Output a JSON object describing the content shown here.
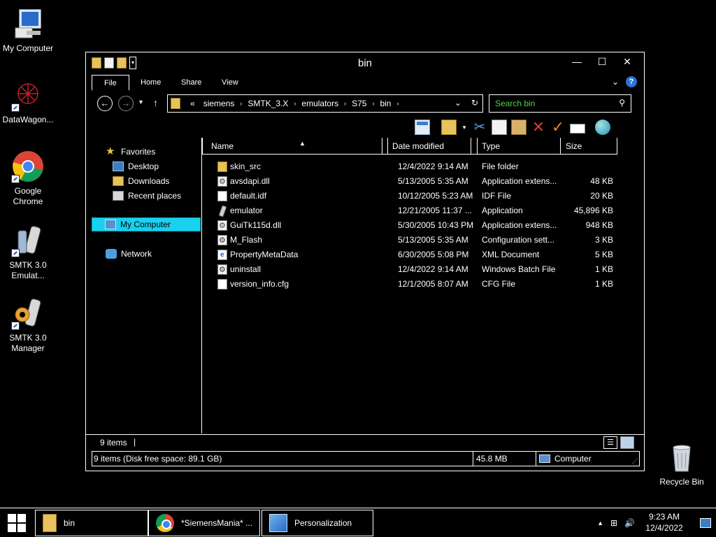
{
  "desktop": {
    "icons": [
      {
        "label": "My Computer"
      },
      {
        "label": "DataWagon..."
      },
      {
        "label": "Google Chrome"
      },
      {
        "label": "SMTK 3.0 Emulat..."
      },
      {
        "label": "SMTK 3.0 Manager"
      },
      {
        "label": "Recycle Bin"
      }
    ]
  },
  "window": {
    "title": "bin",
    "controls": {
      "minimize": "—",
      "maximize": "☐",
      "close": "✕"
    },
    "ribbon": {
      "tabs": [
        "File",
        "Home",
        "Share",
        "View"
      ],
      "help": "?"
    },
    "nav": {
      "back": "←",
      "forward": "→",
      "recent": "▾",
      "up": "↑",
      "address_prefix": "«",
      "breadcrumb": [
        "siemens",
        "SMTK_3.X",
        "emulators",
        "S75",
        "bin"
      ],
      "separator": "›",
      "dropdown": "⌄",
      "refresh": "↻",
      "search_placeholder": "Search bin",
      "search_icon": "⚲"
    },
    "sidebar": {
      "favorites": "Favorites",
      "items": [
        "Desktop",
        "Downloads",
        "Recent places"
      ],
      "computer": "My Computer",
      "network": "Network"
    },
    "columns": {
      "name": "Name",
      "date": "Date modified",
      "type": "Type",
      "size": "Size"
    },
    "files": [
      {
        "name": "skin_src",
        "date": "12/4/2022 9:14 AM",
        "type": "File folder",
        "size": "",
        "icon": "folder"
      },
      {
        "name": "avsdapi.dll",
        "date": "5/13/2005 5:35 AM",
        "type": "Application extens...",
        "size": "48 KB",
        "icon": "dll"
      },
      {
        "name": "default.idf",
        "date": "10/12/2005 5:23 AM",
        "type": "IDF File",
        "size": "20 KB",
        "icon": "file"
      },
      {
        "name": "emulator",
        "date": "12/21/2005 11:37 ...",
        "type": "Application",
        "size": "45,896 KB",
        "icon": "app"
      },
      {
        "name": "GuiTk115d.dll",
        "date": "5/30/2005 10:43 PM",
        "type": "Application extens...",
        "size": "948 KB",
        "icon": "dll"
      },
      {
        "name": "M_Flash",
        "date": "5/13/2005 5:35 AM",
        "type": "Configuration sett...",
        "size": "3 KB",
        "icon": "config"
      },
      {
        "name": "PropertyMetaData",
        "date": "6/30/2005 5:08 PM",
        "type": "XML Document",
        "size": "5 KB",
        "icon": "xml"
      },
      {
        "name": "uninstall",
        "date": "12/4/2022 9:14 AM",
        "type": "Windows Batch File",
        "size": "1 KB",
        "icon": "bat"
      },
      {
        "name": "version_info.cfg",
        "date": "12/1/2005 8:07 AM",
        "type": "CFG File",
        "size": "1 KB",
        "icon": "file"
      }
    ],
    "status": {
      "count": "9 items",
      "cursor": "|",
      "detail": "9 items (Disk free space: 89.1 GB)",
      "size": "45.8 MB",
      "location": "Computer",
      "grip": "⋰"
    }
  },
  "taskbar": {
    "tasks": [
      "bin",
      "*SiemensMania* ...",
      "Personalization"
    ],
    "tray": {
      "chevron": "▲",
      "network": "⊞",
      "volume": "🔊"
    },
    "clock": {
      "time": "9:23 AM",
      "date": "12/4/2022"
    }
  }
}
